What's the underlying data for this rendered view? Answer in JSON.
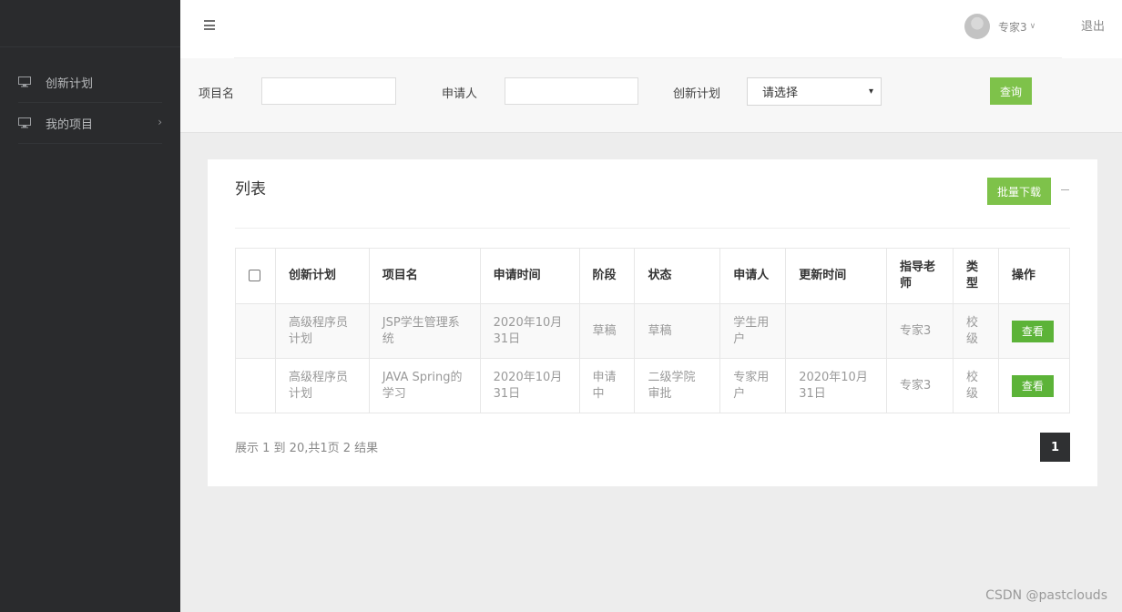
{
  "sidebar": {
    "items": [
      {
        "label": "创新计划",
        "icon": "monitor-icon"
      },
      {
        "label": "我的项目",
        "icon": "monitor-icon",
        "has_submenu": true
      }
    ]
  },
  "topbar": {
    "user_name": "专家3",
    "logout_label": "退出"
  },
  "filters": {
    "project_name_label": "项目名",
    "project_name_value": "",
    "applicant_label": "申请人",
    "applicant_value": "",
    "plan_label": "创新计划",
    "plan_selected": "请选择",
    "query_label": "查询"
  },
  "panel": {
    "title": "列表",
    "batch_download_label": "批量下载"
  },
  "table": {
    "headers": [
      "创新计划",
      "项目名",
      "申请时间",
      "阶段",
      "状态",
      "申请人",
      "更新时间",
      "指导老师",
      "类型",
      "操作"
    ],
    "rows": [
      {
        "plan": "高级程序员计划",
        "project": "JSP学生管理系统",
        "apply_time": "2020年10月31日",
        "stage": "草稿",
        "status": "草稿",
        "applicant": "学生用户",
        "update_time": "",
        "teacher": "专家3",
        "type": "校级",
        "action": "查看"
      },
      {
        "plan": "高级程序员计划",
        "project": "JAVA Spring的学习",
        "apply_time": "2020年10月31日",
        "stage": "申请中",
        "status": "二级学院审批",
        "applicant": "专家用户",
        "update_time": "2020年10月31日",
        "teacher": "专家3",
        "type": "校级",
        "action": "查看"
      }
    ]
  },
  "pagination": {
    "info": "展示 1 到 20,共1页 2 结果",
    "current_page": "1"
  },
  "watermark": "CSDN @pastclouds",
  "colors": {
    "sidebar_bg": "#2a2b2d",
    "accent_green": "#7ec24a",
    "view_green": "#5cb338",
    "page_active": "#2f3032"
  }
}
